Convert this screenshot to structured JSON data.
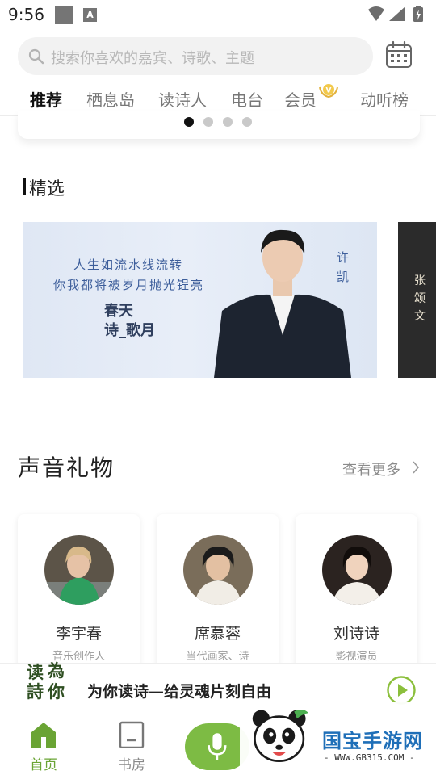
{
  "status_bar": {
    "time": "9:56",
    "a_label": "A"
  },
  "search": {
    "placeholder": "搜索你喜欢的嘉宾、诗歌、主题"
  },
  "tabs": [
    {
      "label": "推荐",
      "active": true
    },
    {
      "label": "栖息岛",
      "active": false
    },
    {
      "label": "读诗人",
      "active": false
    },
    {
      "label": "电台",
      "active": false
    },
    {
      "label": "会员",
      "active": false
    },
    {
      "label": "动听榜",
      "active": false
    }
  ],
  "carousel": {
    "dot_count": 4,
    "active_dot": 0
  },
  "featured": {
    "title": "精选",
    "card1": {
      "line1": "人生如流水线流转",
      "line2": "你我都将被岁月抛光锃亮",
      "sub1": "春天",
      "sub2": "诗_歌月",
      "name": "许凯"
    },
    "card2": {
      "name": "张颂文"
    }
  },
  "gifts": {
    "title": "声音礼物",
    "see_more": "查看更多",
    "people": [
      {
        "name": "李宇春",
        "role": "音乐创作人"
      },
      {
        "name": "席慕蓉",
        "role": "当代画家、诗"
      },
      {
        "name": "刘诗诗",
        "role": "影视演员"
      }
    ]
  },
  "player": {
    "logo_text": "读为诗你",
    "title": "为你读诗—给灵魂片刻自由"
  },
  "nav": {
    "home": "首页",
    "library": "书房"
  },
  "watermark": {
    "text": "国宝手游网",
    "url": "- WWW.GB315.COM -"
  },
  "colors": {
    "accent": "#7fb53a",
    "watermark_blue": "#1f6fb8"
  }
}
